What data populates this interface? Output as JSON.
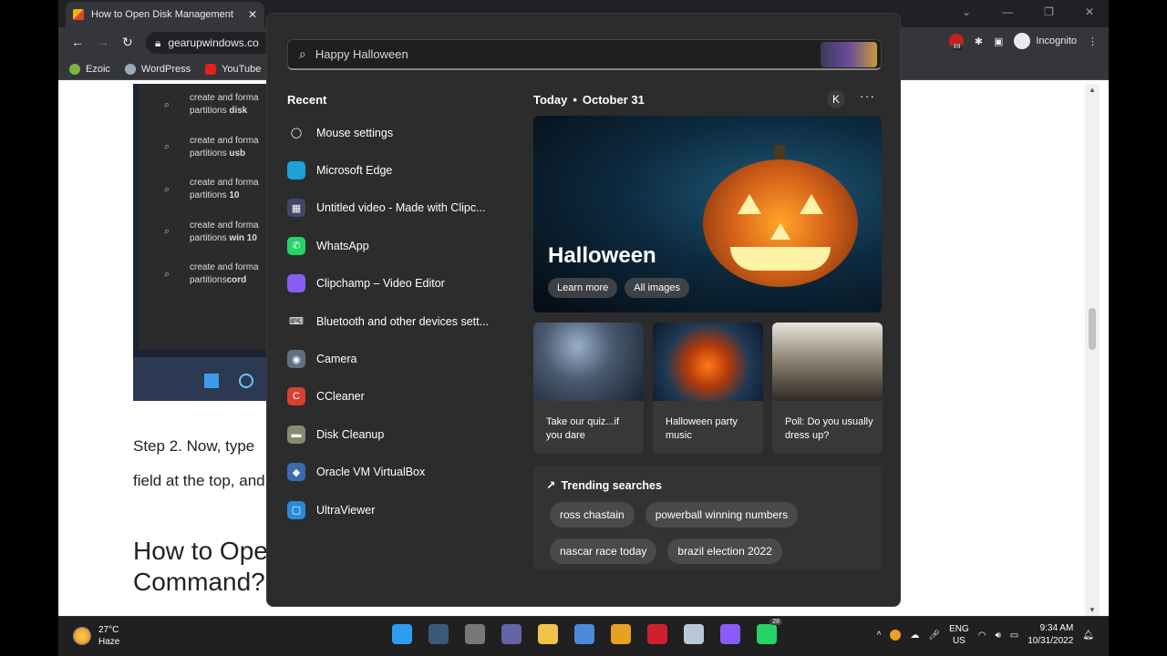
{
  "browser": {
    "tab_title": "How to Open Disk Management",
    "tab_close": "✕",
    "window_controls": [
      "⌄",
      "—",
      "❐",
      "✕"
    ],
    "url": "gearupwindows.co",
    "incognito_label": "Incognito",
    "ext_badge": "89",
    "bookmarks": [
      "Ezoic",
      "WordPress",
      "YouTube"
    ]
  },
  "page": {
    "screenshot_rows": [
      {
        "line1": "create and forma",
        "line2_prefix": "partitions ",
        "line2_bold": "disk"
      },
      {
        "line1": "create and forma",
        "line2_prefix": "partitions ",
        "line2_bold": "usb"
      },
      {
        "line1": "create and forma",
        "line2_prefix": "partitions ",
        "line2_bold": "10"
      },
      {
        "line1": "create and forma",
        "line2_prefix": "partitions ",
        "line2_bold": "win 10"
      },
      {
        "line1": "create and forma",
        "line2_prefix": "partitions",
        "line2_bold": "cord"
      }
    ],
    "step_text": "Step 2. Now, type",
    "step_text_2": "field at the top, and",
    "heading_line1": "How to Ope",
    "heading_line2": "Command?"
  },
  "start": {
    "search_value": "Happy Halloween",
    "recent_title": "Recent",
    "recent": [
      {
        "label": "Mouse settings",
        "icon": "mouse-icon",
        "color": "#2c2c2c"
      },
      {
        "label": "Microsoft Edge",
        "icon": "edge-icon",
        "color": "#1aa3d9"
      },
      {
        "label": "Untitled video - Made with Clipc...",
        "icon": "video-icon",
        "color": "#44446a"
      },
      {
        "label": "WhatsApp",
        "icon": "whatsapp-icon",
        "color": "#25d366"
      },
      {
        "label": "Clipchamp – Video Editor",
        "icon": "clipchamp-icon",
        "color": "#8a5cf6"
      },
      {
        "label": "Bluetooth and other devices sett...",
        "icon": "keyboard-icon",
        "color": "#2c2c2c"
      },
      {
        "label": "Camera",
        "icon": "camera-icon",
        "color": "#607080"
      },
      {
        "label": "CCleaner",
        "icon": "ccleaner-icon",
        "color": "#d84030"
      },
      {
        "label": "Disk Cleanup",
        "icon": "disk-cleanup-icon",
        "color": "#8a8a70"
      },
      {
        "label": "Oracle VM VirtualBox",
        "icon": "virtualbox-icon",
        "color": "#3a6ab0"
      },
      {
        "label": "UltraViewer",
        "icon": "ultraviewer-icon",
        "color": "#2a8ad8"
      }
    ],
    "today_label": "Today",
    "today_date": "October 31",
    "account_initial": "K",
    "more": "···",
    "hero": {
      "title": "Halloween",
      "btn1": "Learn more",
      "btn2": "All images"
    },
    "cards": [
      {
        "caption": "Take our quiz...if you dare"
      },
      {
        "caption": "Halloween party music"
      },
      {
        "caption": "Poll: Do you usually dress up?"
      }
    ],
    "trending_title": "Trending searches",
    "trending": [
      "ross chastain",
      "powerball winning numbers",
      "nascar race today",
      "brazil election 2022"
    ]
  },
  "taskbar": {
    "temp": "27°C",
    "weather": "Haze",
    "lang1": "ENG",
    "lang2": "US",
    "time": "9:34 AM",
    "date": "10/31/2022",
    "whatsapp_count": "28",
    "icons": [
      {
        "name": "windows-start-icon",
        "color": "#2b9df2"
      },
      {
        "name": "search-icon",
        "color": "#3a5a7a"
      },
      {
        "name": "task-view-icon",
        "color": "#777777"
      },
      {
        "name": "teams-chat-icon",
        "color": "#6264a7"
      },
      {
        "name": "file-explorer-icon",
        "color": "#f2c24a"
      },
      {
        "name": "store-icon",
        "color": "#4a8ad8"
      },
      {
        "name": "chrome-icon",
        "color": "#e8a020"
      },
      {
        "name": "huawei-icon",
        "color": "#d02030"
      },
      {
        "name": "notepad-icon",
        "color": "#b8c8d8"
      },
      {
        "name": "clipchamp-taskbar-icon",
        "color": "#8a5cf6"
      },
      {
        "name": "whatsapp-taskbar-icon",
        "color": "#25d366"
      }
    ]
  }
}
